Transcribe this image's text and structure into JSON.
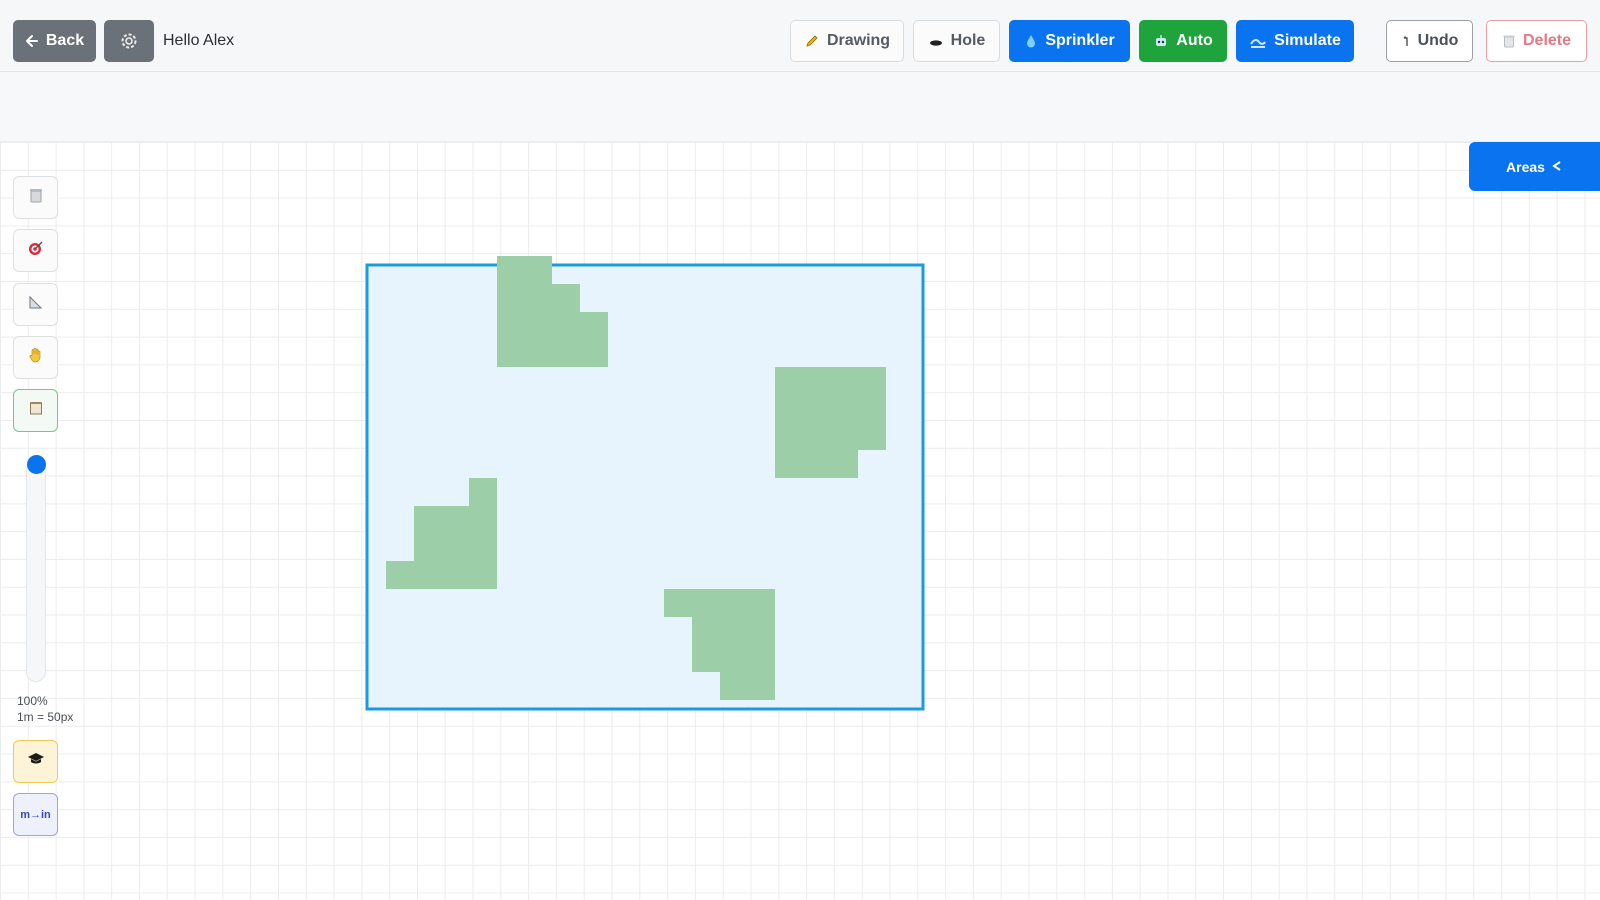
{
  "header": {
    "back_label": "Back",
    "greeting": "Hello Alex",
    "tools": {
      "drawing": "Drawing",
      "hole": "Hole",
      "sprinkler": "Sprinkler",
      "auto": "Auto",
      "simulate": "Simulate"
    },
    "undo_label": "Undo",
    "delete_label": "Delete"
  },
  "icons": {
    "back": "arrow-left-icon",
    "settings": "gear-icon",
    "drawing": "pencil-icon",
    "hole": "hole-icon",
    "sprinkler": "water-drop-icon",
    "auto": "robot-icon",
    "simulate": "wave-icon",
    "undo": "undo-icon",
    "delete": "trash-icon",
    "areas": "chevron-left-icon"
  },
  "areas_panel": {
    "label": "Areas"
  },
  "sidebar": {
    "tools": [
      "trash-tool",
      "target-tool",
      "ruler-tool",
      "hand-tool",
      "notepad-tool"
    ],
    "zoom_percent": "100%",
    "scale": "1m = 50px",
    "zoom_level": 1.0,
    "unit_toggle": "m→in"
  },
  "colors": {
    "primary": "#0a73f0",
    "success": "#1fa33c",
    "danger": "#e07a84",
    "area_fill": "#e8f4fd",
    "area_stroke": "#1a9be0",
    "grass": "#9ccfa8"
  }
}
